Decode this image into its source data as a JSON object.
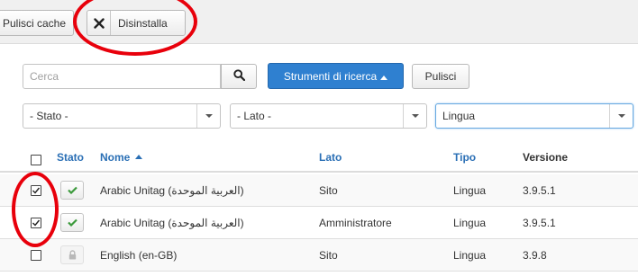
{
  "toolbar": {
    "clear_cache_label": "Pulisci cache",
    "uninstall_label": "Disinstalla"
  },
  "search": {
    "placeholder": "Cerca",
    "value": "",
    "tools_label": "Strumenti di ricerca",
    "clear_label": "Pulisci"
  },
  "filters": {
    "status_value": "- Stato -",
    "side_value": "- Lato -",
    "type_value": "Lingua"
  },
  "table": {
    "headers": {
      "status": "Stato",
      "name": "Nome",
      "side": "Lato",
      "type": "Tipo",
      "version": "Versione"
    },
    "rows": [
      {
        "name": "Arabic Unitag (العربية الموحدة)",
        "side": "Sito",
        "type": "Lingua",
        "version": "3.9.5.1",
        "checked": true,
        "status": "enabled"
      },
      {
        "name": "Arabic Unitag (العربية الموحدة)",
        "side": "Amministratore",
        "type": "Lingua",
        "version": "3.9.5.1",
        "checked": true,
        "status": "enabled"
      },
      {
        "name": "English (en-GB)",
        "side": "Sito",
        "type": "Lingua",
        "version": "3.9.8",
        "checked": false,
        "status": "locked"
      }
    ]
  },
  "icons": {
    "uninstall": "close-icon",
    "search": "search-icon",
    "enabled": "check-icon",
    "locked": "lock-icon",
    "sort": "caret-up-icon"
  },
  "colors": {
    "accent": "#2f80d0",
    "link": "#2a6fb5",
    "check_green": "#3c9a3c",
    "annotation_red": "#e8000b"
  }
}
